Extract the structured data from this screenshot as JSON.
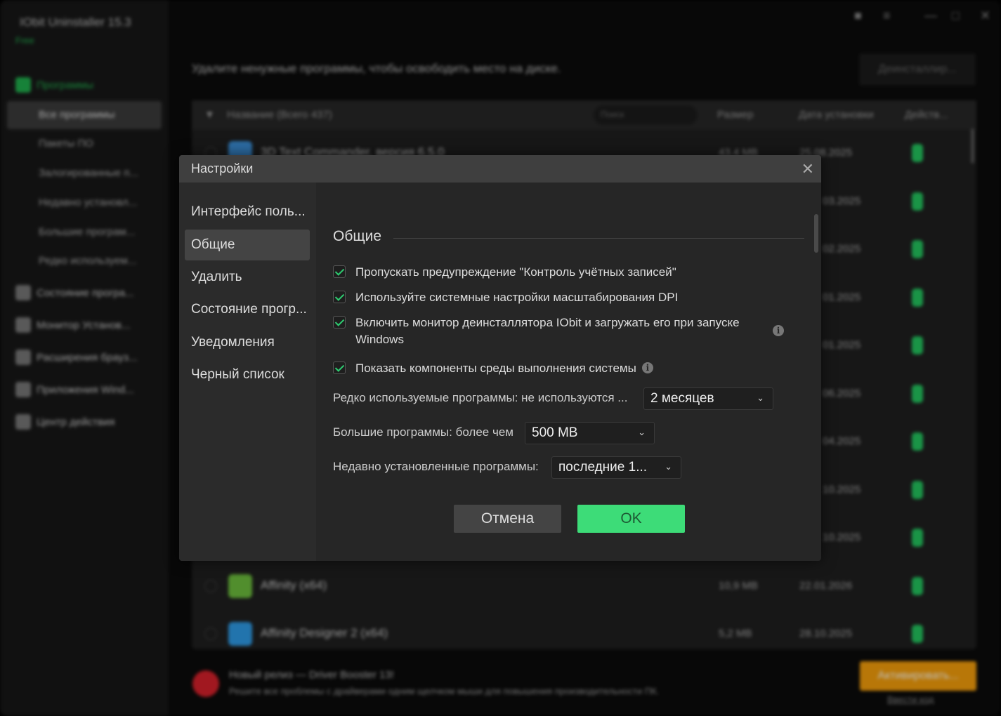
{
  "app": {
    "title": "IObit Uninstaller 15.3",
    "plan": "Free",
    "sidebar": {
      "programs": "Программы",
      "items": [
        "Все программы",
        "Пакеты ПО",
        "Залогированные п...",
        "Недавно установл...",
        "Большие програм...",
        "Редко используем..."
      ],
      "groups": [
        "Состояние програ...",
        "Монитор Установ...",
        "Расширения брауз...",
        "Приложения Wind...",
        "Центр действия"
      ]
    },
    "subtitle": "Удалите ненужные программы, чтобы освободить место на диске.",
    "uninstall_button": "Деинсталлир...",
    "table": {
      "header_name": "Название (Всего 437)",
      "search_placeholder": "Поиск",
      "header_size": "Размер",
      "header_date": "Дата установки",
      "header_action": "Действ...",
      "rows": [
        {
          "name": "3D Text Commander, версия 6.5.0",
          "size": "43.4 MB",
          "date": "25.08.2025"
        },
        {
          "name": "",
          "size": "",
          "date": "03.2025"
        },
        {
          "name": "",
          "size": "",
          "date": "02.2025"
        },
        {
          "name": "",
          "size": "",
          "date": "01.2025"
        },
        {
          "name": "",
          "size": "",
          "date": "01.2025"
        },
        {
          "name": "",
          "size": "",
          "date": "06.2025"
        },
        {
          "name": "",
          "size": "",
          "date": "04.2025"
        },
        {
          "name": "",
          "size": "",
          "date": "10.2025"
        },
        {
          "name": "",
          "size": "",
          "date": "10.2025"
        },
        {
          "name": "Affinity (x64)",
          "size": "10,9 MB",
          "date": "22.01.2026"
        },
        {
          "name": "Affinity Designer 2 (x64)",
          "size": "5,2 MB",
          "date": "28.10.2025"
        }
      ]
    },
    "news": {
      "title": "Новый релиз — Driver Booster 13!",
      "text": "Решите все проблемы с драйверами одним щелчком мыши для повышения производительности ПК."
    },
    "activate_button": "Активировать...",
    "enter_code": "Ввести код"
  },
  "dialog": {
    "title": "Настройки",
    "nav": [
      "Интерфейс поль...",
      "Общие",
      "Удалить",
      "Состояние прогр...",
      "Уведомления",
      "Черный список"
    ],
    "active_nav": "Общие",
    "section_title": "Общие",
    "options": [
      {
        "label": "Пропускать предупреждение \"Контроль учётных записей\"",
        "checked": true
      },
      {
        "label": "Используйте системные настройки масштабирования DPI",
        "checked": true
      },
      {
        "label": "Включить монитор деинсталлятора IObit и загружать его при запуске Windows",
        "checked": true
      },
      {
        "label": "Показать компоненты среды выполнения системы",
        "checked": true
      }
    ],
    "rarely_used": {
      "label": "Редко используемые программы: не используются ...",
      "value": "2 месяцев"
    },
    "large": {
      "label": "Большие программы: более чем",
      "value": "500 MB"
    },
    "recent": {
      "label": "Недавно установленные программы:",
      "value": "последние 1..."
    },
    "cancel": "Отмена",
    "ok": "OK"
  },
  "colors": {
    "accent": "#3ddc78",
    "activate": "#f59f0b"
  }
}
